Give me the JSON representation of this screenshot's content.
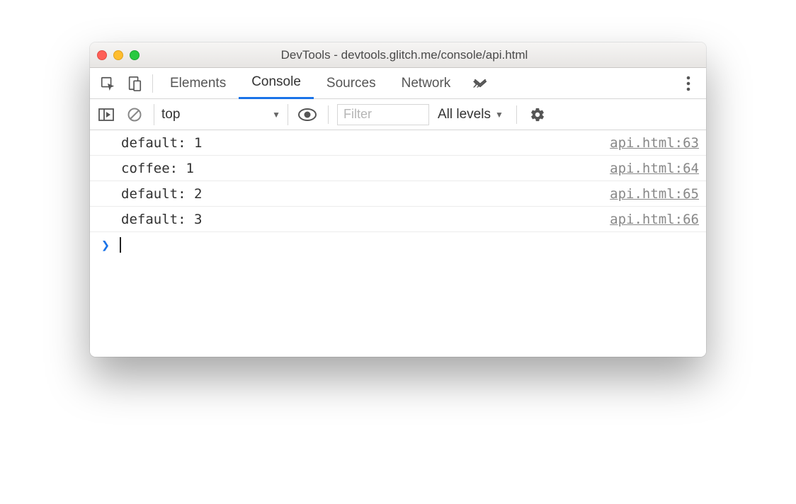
{
  "window": {
    "title": "DevTools - devtools.glitch.me/console/api.html"
  },
  "tabs": {
    "items": [
      "Elements",
      "Console",
      "Sources",
      "Network"
    ],
    "active_index": 1
  },
  "toolbar": {
    "context": "top",
    "filter_placeholder": "Filter",
    "levels_label": "All levels"
  },
  "console": {
    "rows": [
      {
        "message": "default: 1",
        "source": "api.html:63"
      },
      {
        "message": "coffee: 1",
        "source": "api.html:64"
      },
      {
        "message": "default: 2",
        "source": "api.html:65"
      },
      {
        "message": "default: 3",
        "source": "api.html:66"
      }
    ]
  }
}
